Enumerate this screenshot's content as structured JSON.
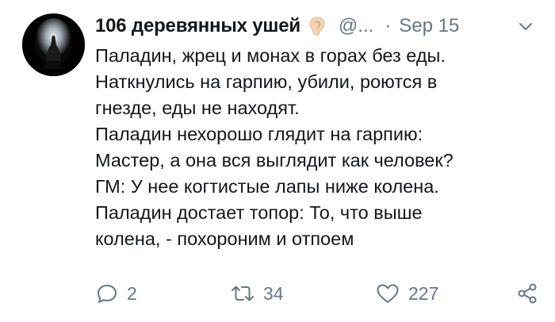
{
  "tweet": {
    "author": {
      "display_name": "106 деревянных ушей",
      "name_emoji": "ear-icon",
      "handle": "@...",
      "avatar": "avatar"
    },
    "separator": "·",
    "date": "Sep 15",
    "body_lines": [
      "Паладин, жрец и монах в горах без еды.",
      "Наткнулись на гарпию, убили, роются в",
      "гнезде, еды не находят.",
      "Паладин нехорошо глядит на гарпию:",
      "Мастер, а она вся выглядит как человек?",
      "ГМ: У нее когтистые лапы ниже колена.",
      "Паладин достает топор: То, что выше",
      "колена, - похороним и отпоем"
    ],
    "actions": {
      "reply": {
        "icon": "reply-icon",
        "count": "2"
      },
      "retweet": {
        "icon": "retweet-icon",
        "count": "34"
      },
      "like": {
        "icon": "heart-icon",
        "count": "227"
      },
      "share": {
        "icon": "share-icon"
      }
    },
    "menu_icon": "chevron-down-icon"
  },
  "colors": {
    "text_primary": "#14171a",
    "text_secondary": "#657786",
    "background": "#ffffff"
  }
}
